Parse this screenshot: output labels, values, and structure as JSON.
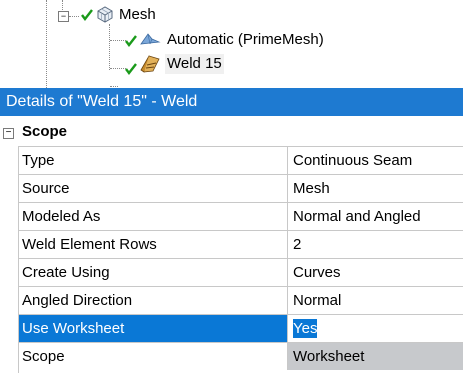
{
  "tree": {
    "mesh_label": "Mesh",
    "automatic_label": "Automatic (PrimeMesh)",
    "weld_label": "Weld 15"
  },
  "details": {
    "title": "Details of \"Weld 15\" - Weld",
    "section": {
      "label": "Scope",
      "collapse_glyph": "−"
    },
    "rows": [
      {
        "name": "Type",
        "value": "Continuous Seam"
      },
      {
        "name": "Source",
        "value": "Mesh"
      },
      {
        "name": "Modeled As",
        "value": "Normal and Angled"
      },
      {
        "name": "Weld Element Rows",
        "value": "2"
      },
      {
        "name": "Create Using",
        "value": "Curves"
      },
      {
        "name": "Angled Direction",
        "value": "Normal"
      },
      {
        "name": "Use Worksheet",
        "value": "Yes"
      },
      {
        "name": "Scope",
        "value": "Worksheet"
      }
    ]
  },
  "colors": {
    "header_bg": "#1e7ad1",
    "selection": "#0a78d6",
    "readonly_bg": "#c7c9cc",
    "check_green": "#1a9a1a"
  },
  "icons": {
    "expander": "minus-expander-icon",
    "check": "green-check-icon",
    "mesh": "mesh-cube-icon",
    "automatic": "automatic-mesh-icon",
    "weld": "weld-icon"
  }
}
